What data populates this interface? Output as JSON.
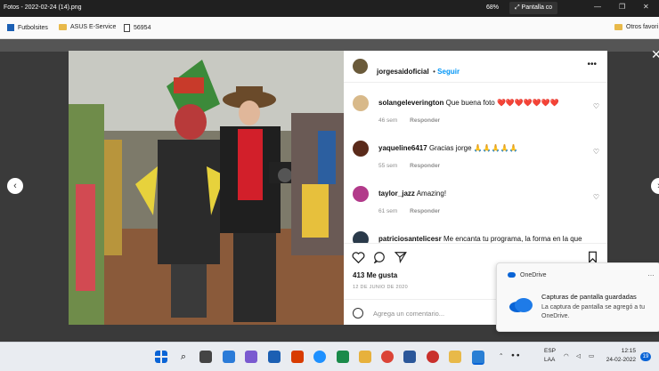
{
  "titlebar": {
    "title": "Fotos - 2022-02-24 (14).png",
    "zoom": "68%",
    "fullscreen_label": "Pantalla co"
  },
  "bookmarks": [
    {
      "label": "Futbolsites",
      "icon": "futbolsites-icon"
    },
    {
      "label": "ASUS E-Service",
      "icon": "folder-icon"
    },
    {
      "label": "56954",
      "icon": "document-icon"
    },
    {
      "label": "Otros favori",
      "icon": "folder-icon"
    }
  ],
  "post": {
    "author": "jorgesaidoficial",
    "follow_label": "Seguir",
    "likes": "413 Me gusta",
    "date": "12 DE JUNIO DE 2020",
    "add_comment_placeholder": "Agrega un comentario..."
  },
  "comments": [
    {
      "user": "solangeleverington",
      "text": "Que buena foto ❤️❤️❤️❤️❤️❤️❤️",
      "time": "46 sem",
      "reply": "Responder",
      "avatar_color": "#d8b98a"
    },
    {
      "user": "yaqueline6417",
      "text": "Gracias jorge 🙏🙏🙏🙏🙏",
      "time": "55 sem",
      "reply": "Responder",
      "avatar_color": "#5a2a1a"
    },
    {
      "user": "taylor_jazz",
      "text": "Amazing!",
      "time": "61 sem",
      "reply": "Responder",
      "avatar_color": "#b23a8a"
    },
    {
      "user": "patriciosantelicesr",
      "text": "Me encanta tu programa, la forma en la que",
      "time": "",
      "reply": "",
      "avatar_color": "#2a3a4a"
    }
  ],
  "toast": {
    "app": "OneDrive",
    "title": "Capturas de pantalla guardadas",
    "body": "La captura de pantalla se agregó a tu OneDrive."
  },
  "tray": {
    "lang": "ESP",
    "layout": "LAA",
    "time": "12:15",
    "date": "24-02-2022",
    "notifications": "19"
  },
  "colors": {
    "accent": "#0095f6",
    "heart": "#ed4956",
    "onedrive": "#0a64d6"
  }
}
